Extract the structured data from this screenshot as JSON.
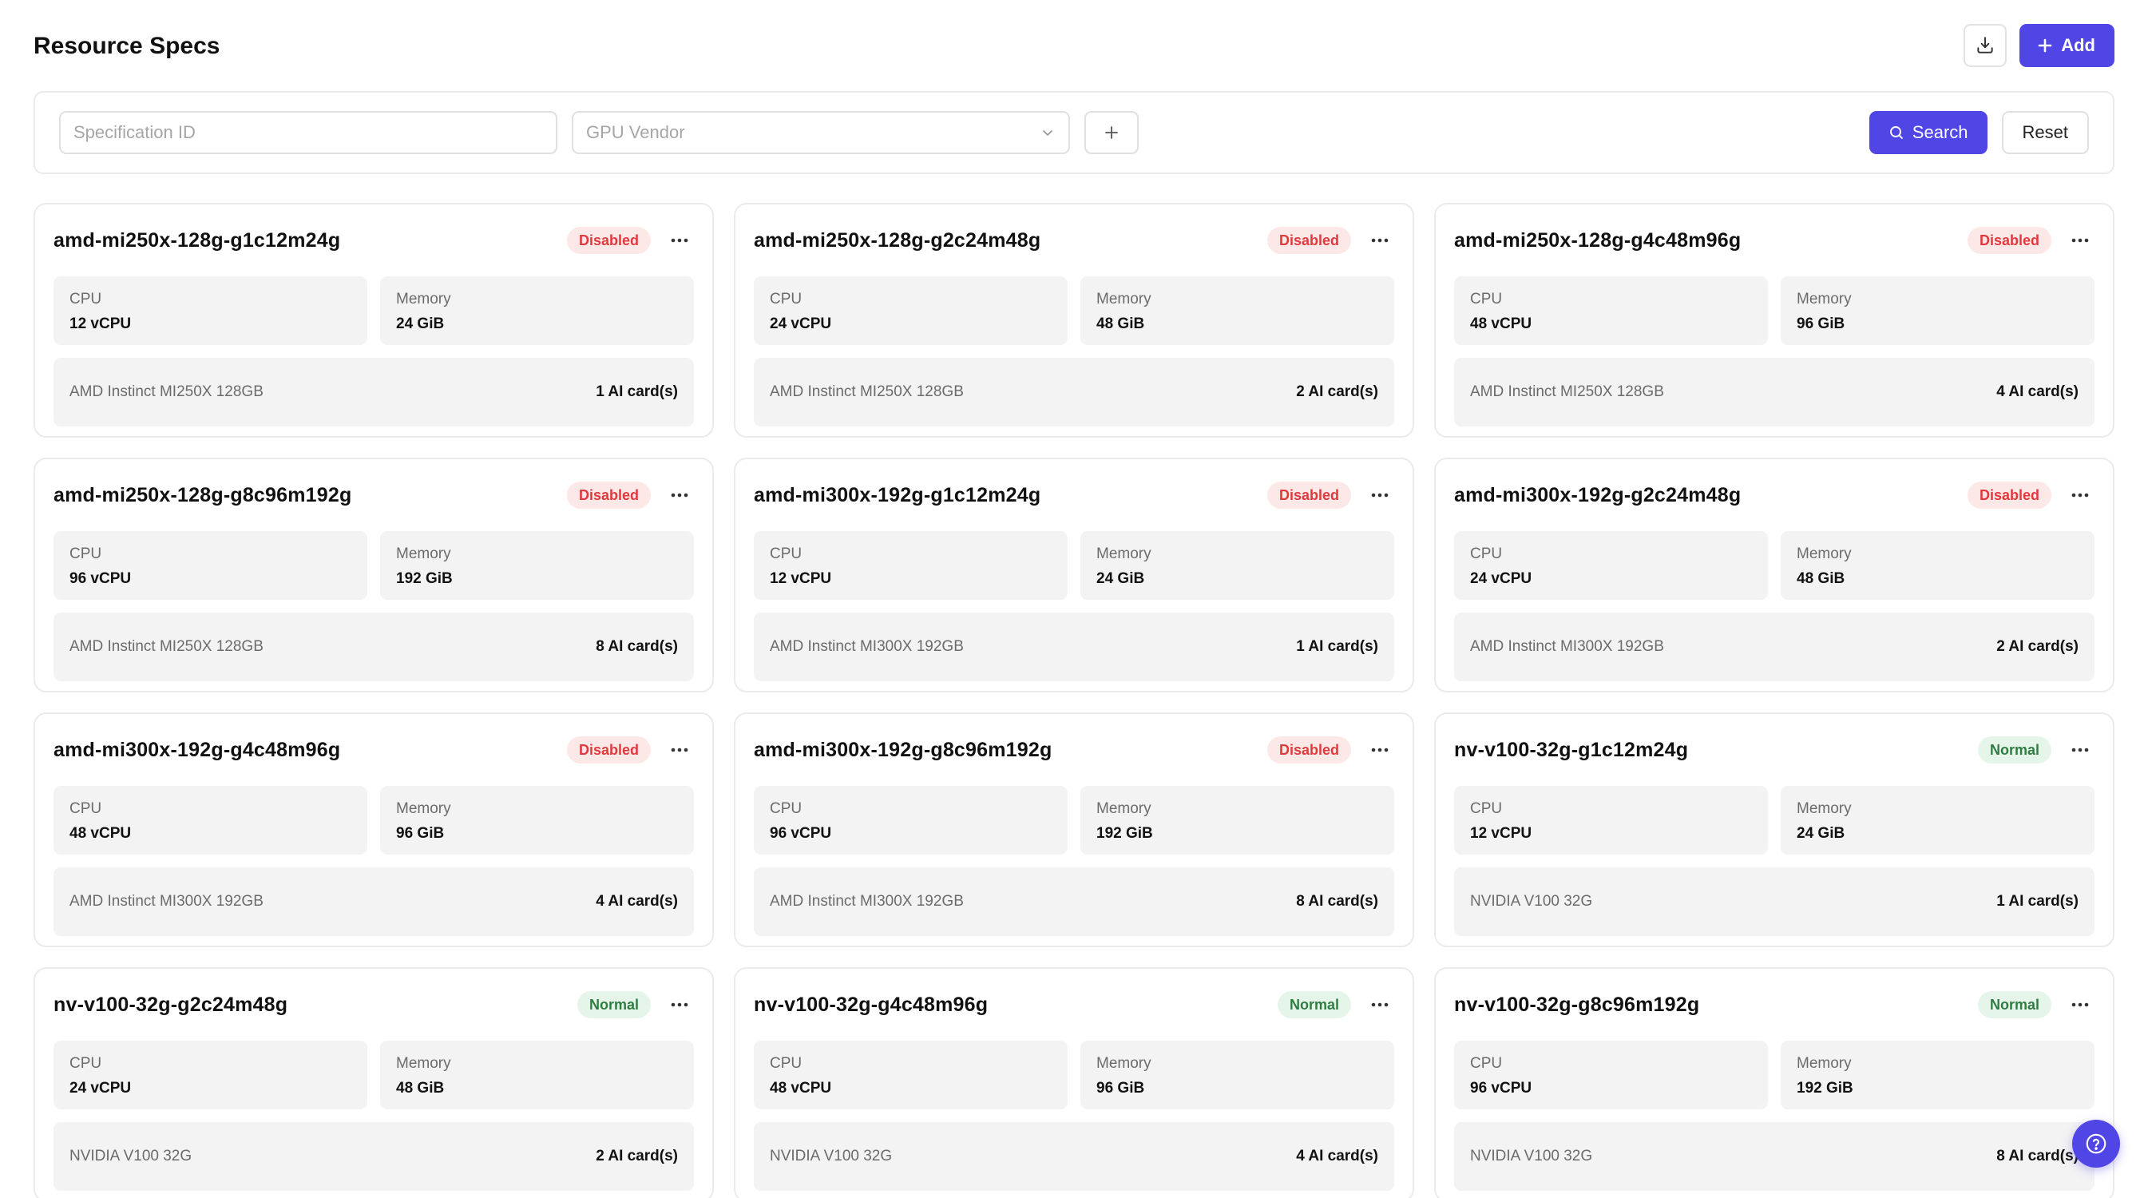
{
  "header": {
    "title": "Resource Specs",
    "export_icon": "download-tray-icon",
    "add_label": "Add",
    "add_icon": "plus-icon"
  },
  "filters": {
    "spec_id_placeholder": "Specification ID",
    "gpu_vendor_placeholder": "GPU Vendor",
    "search_label": "Search",
    "reset_label": "Reset"
  },
  "colors": {
    "accent": "#5046e5",
    "disabled_bg": "#fde8e8",
    "disabled_text": "#e0393e",
    "normal_bg": "#e6f5ea",
    "normal_text": "#2f7d43"
  },
  "specs": [
    {
      "name": "amd-mi250x-128g-g1c12m24g",
      "status": "Disabled",
      "cpu_label": "CPU",
      "cpu": "12 vCPU",
      "mem_label": "Memory",
      "memory": "24 GiB",
      "gpu": "AMD Instinct MI250X 128GB",
      "cards": "1 AI card(s)"
    },
    {
      "name": "amd-mi250x-128g-g2c24m48g",
      "status": "Disabled",
      "cpu_label": "CPU",
      "cpu": "24 vCPU",
      "mem_label": "Memory",
      "memory": "48 GiB",
      "gpu": "AMD Instinct MI250X 128GB",
      "cards": "2 AI card(s)"
    },
    {
      "name": "amd-mi250x-128g-g4c48m96g",
      "status": "Disabled",
      "cpu_label": "CPU",
      "cpu": "48 vCPU",
      "mem_label": "Memory",
      "memory": "96 GiB",
      "gpu": "AMD Instinct MI250X 128GB",
      "cards": "4 AI card(s)"
    },
    {
      "name": "amd-mi250x-128g-g8c96m192g",
      "status": "Disabled",
      "cpu_label": "CPU",
      "cpu": "96 vCPU",
      "mem_label": "Memory",
      "memory": "192 GiB",
      "gpu": "AMD Instinct MI250X 128GB",
      "cards": "8 AI card(s)"
    },
    {
      "name": "amd-mi300x-192g-g1c12m24g",
      "status": "Disabled",
      "cpu_label": "CPU",
      "cpu": "12 vCPU",
      "mem_label": "Memory",
      "memory": "24 GiB",
      "gpu": "AMD Instinct MI300X 192GB",
      "cards": "1 AI card(s)"
    },
    {
      "name": "amd-mi300x-192g-g2c24m48g",
      "status": "Disabled",
      "cpu_label": "CPU",
      "cpu": "24 vCPU",
      "mem_label": "Memory",
      "memory": "48 GiB",
      "gpu": "AMD Instinct MI300X 192GB",
      "cards": "2 AI card(s)"
    },
    {
      "name": "amd-mi300x-192g-g4c48m96g",
      "status": "Disabled",
      "cpu_label": "CPU",
      "cpu": "48 vCPU",
      "mem_label": "Memory",
      "memory": "96 GiB",
      "gpu": "AMD Instinct MI300X 192GB",
      "cards": "4 AI card(s)"
    },
    {
      "name": "amd-mi300x-192g-g8c96m192g",
      "status": "Disabled",
      "cpu_label": "CPU",
      "cpu": "96 vCPU",
      "mem_label": "Memory",
      "memory": "192 GiB",
      "gpu": "AMD Instinct MI300X 192GB",
      "cards": "8 AI card(s)"
    },
    {
      "name": "nv-v100-32g-g1c12m24g",
      "status": "Normal",
      "cpu_label": "CPU",
      "cpu": "12 vCPU",
      "mem_label": "Memory",
      "memory": "24 GiB",
      "gpu": "NVIDIA V100 32G",
      "cards": "1 AI card(s)"
    },
    {
      "name": "nv-v100-32g-g2c24m48g",
      "status": "Normal",
      "cpu_label": "CPU",
      "cpu": "24 vCPU",
      "mem_label": "Memory",
      "memory": "48 GiB",
      "gpu": "NVIDIA V100 32G",
      "cards": "2 AI card(s)"
    },
    {
      "name": "nv-v100-32g-g4c48m96g",
      "status": "Normal",
      "cpu_label": "CPU",
      "cpu": "48 vCPU",
      "mem_label": "Memory",
      "memory": "96 GiB",
      "gpu": "NVIDIA V100 32G",
      "cards": "4 AI card(s)"
    },
    {
      "name": "nv-v100-32g-g8c96m192g",
      "status": "Normal",
      "cpu_label": "CPU",
      "cpu": "96 vCPU",
      "mem_label": "Memory",
      "memory": "192 GiB",
      "gpu": "NVIDIA V100 32G",
      "cards": "8 AI card(s)"
    }
  ],
  "help_icon": "help-circle-icon"
}
